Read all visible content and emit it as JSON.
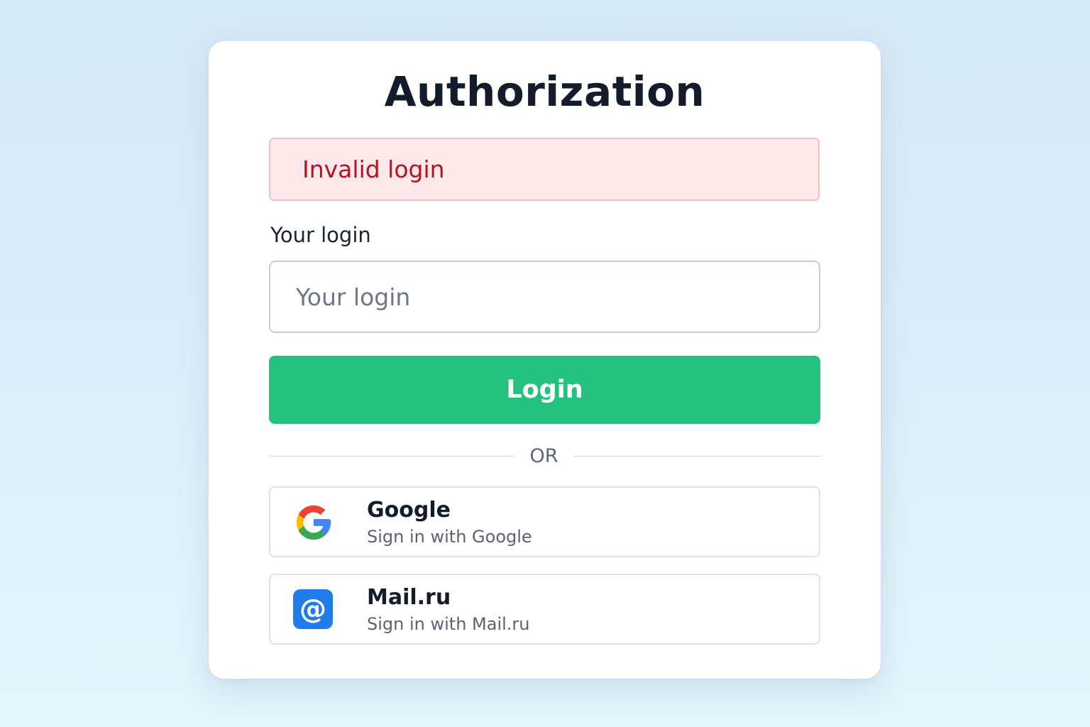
{
  "auth": {
    "title": "Authorization",
    "error_message": "Invalid login",
    "login_field": {
      "label": "Your login",
      "placeholder": "Your login",
      "value": ""
    },
    "login_button_label": "Login",
    "divider_label": "OR",
    "providers": [
      {
        "name": "Google",
        "subtitle": "Sign in with Google",
        "icon": "google-logo-icon"
      },
      {
        "name": "Mail.ru",
        "subtitle": "Sign in with Mail.ru",
        "icon": "mail-ru-at-icon"
      }
    ]
  },
  "colors": {
    "background": "#d9ecf8",
    "card": "#ffffff",
    "error_bg": "#fee8ea",
    "error_border": "#f1c0c6",
    "error_text": "#b3141f",
    "primary_button": "#24c27f",
    "mail_ru_blue": "#1f7ce8",
    "google_red": "#ea4335",
    "google_yellow": "#fbbc05",
    "google_green": "#34a853",
    "google_blue": "#4285f4"
  }
}
